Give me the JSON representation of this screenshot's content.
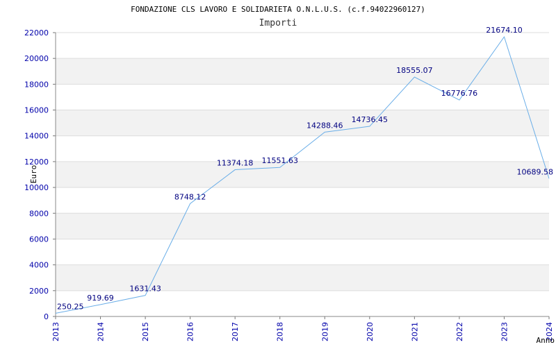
{
  "chart_data": {
    "type": "line",
    "title": "FONDAZIONE CLS LAVORO E SOLIDARIETA O.N.L.U.S. (c.f.94022960127)",
    "subtitle": "Importi",
    "xlabel": "Anno",
    "ylabel": "Euro",
    "ylim": [
      0,
      22000
    ],
    "yticks": [
      0,
      2000,
      4000,
      6000,
      8000,
      10000,
      12000,
      14000,
      16000,
      18000,
      20000,
      22000
    ],
    "categories": [
      "2013",
      "2014",
      "2015",
      "2016",
      "2017",
      "2018",
      "2019",
      "2020",
      "2021",
      "2022",
      "2023",
      "2024"
    ],
    "series": [
      {
        "values": [
          250.25,
          919.69,
          1631.43,
          8748.12,
          11374.18,
          11551.63,
          14288.46,
          14736.45,
          18555.07,
          16776.76,
          21674.1,
          10689.58
        ],
        "labels": [
          "250.25",
          "919.69",
          "1631.43",
          "8748.12",
          "11374.18",
          "11551.63",
          "14288.46",
          "14736.45",
          "18555.07",
          "16776.76",
          "21674.10",
          "10689.58"
        ]
      }
    ],
    "line_color": "#6aaee8",
    "band_color": "#f2f2f2",
    "grid_color": "#dddddd",
    "tick_color": "#0000aa",
    "legend": "none",
    "grid": true
  }
}
